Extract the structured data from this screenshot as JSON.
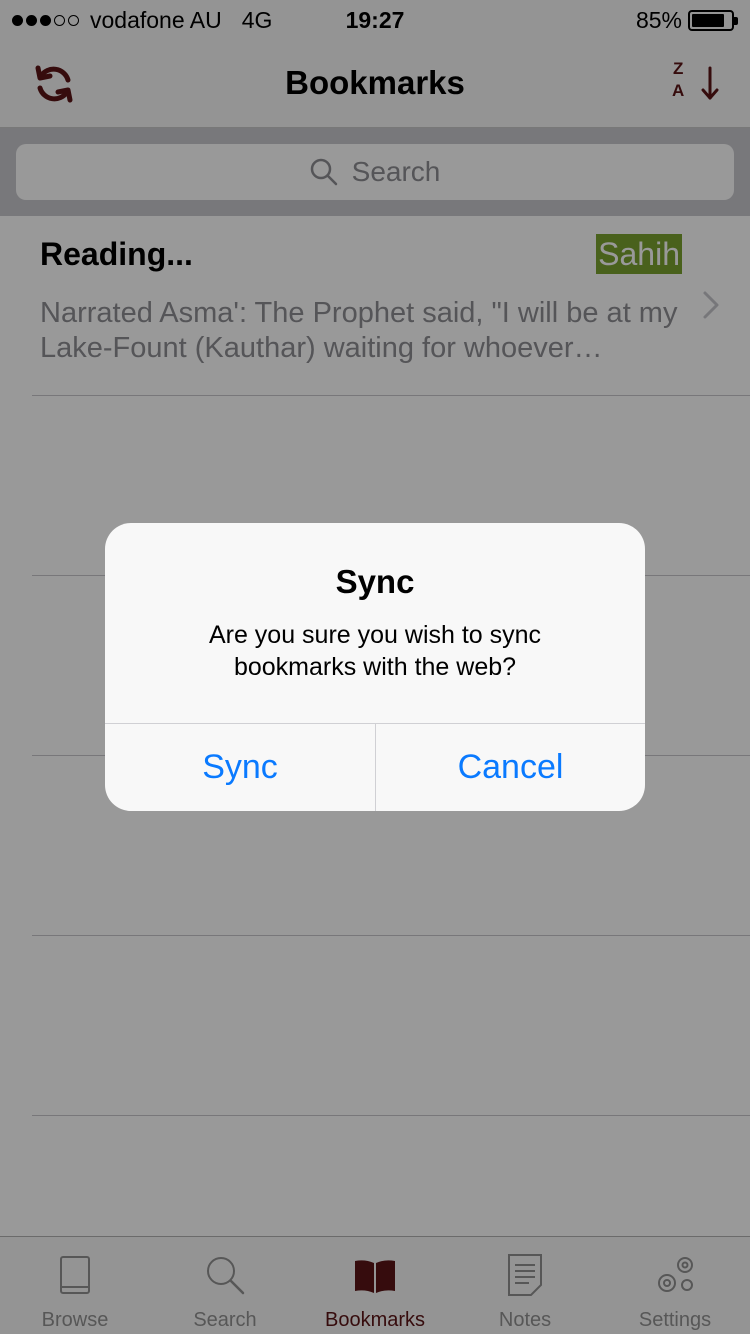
{
  "status_bar": {
    "carrier": "vodafone AU",
    "network": "4G",
    "time": "19:27",
    "battery": "85%",
    "battery_level": 0.85,
    "signal_strength": 3,
    "signal_total": 5
  },
  "nav": {
    "title": "Bookmarks",
    "sort_top_letter": "Z",
    "sort_bottom_letter": "A"
  },
  "search": {
    "placeholder": "Search"
  },
  "bookmarks": [
    {
      "title": "Reading...",
      "badge": "Sahih",
      "excerpt": "Narrated Asma':  The Prophet said, \"I will be at my Lake-Fount (Kauthar) waiting for whoever…"
    }
  ],
  "tab_bar": {
    "tabs": [
      {
        "label": "Browse",
        "icon": "book-icon",
        "active": false
      },
      {
        "label": "Search",
        "icon": "search-icon",
        "active": false
      },
      {
        "label": "Bookmarks",
        "icon": "open-book-icon",
        "active": true
      },
      {
        "label": "Notes",
        "icon": "notes-icon",
        "active": false
      },
      {
        "label": "Settings",
        "icon": "gears-icon",
        "active": false
      }
    ]
  },
  "alert": {
    "title": "Sync",
    "message": "Are you sure you wish to sync bookmarks with the web?",
    "confirm_label": "Sync",
    "cancel_label": "Cancel"
  },
  "colors": {
    "accent": "#5b1416",
    "alert_button": "#0a7aff",
    "badge_background": "#7aa230",
    "tab_inactive": "#929292"
  }
}
